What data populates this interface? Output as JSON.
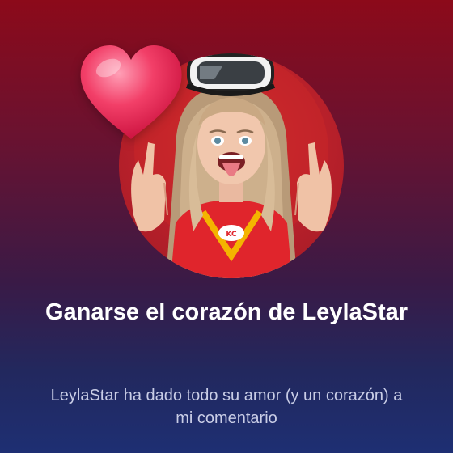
{
  "achievement": {
    "title": "Ganarse el corazón de LeylaStar",
    "description": "LeylaStar ha dado todo su amor (y un corazón) a mi comentario"
  },
  "icons": {
    "badge": "heart-icon",
    "avatar": "creator-avatar"
  },
  "colors": {
    "background_top": "#8c0a1a",
    "background_bottom": "#1e2f73",
    "heart": "#e8214f",
    "title_text": "#ffffff",
    "description_text": "#c9cde6"
  }
}
